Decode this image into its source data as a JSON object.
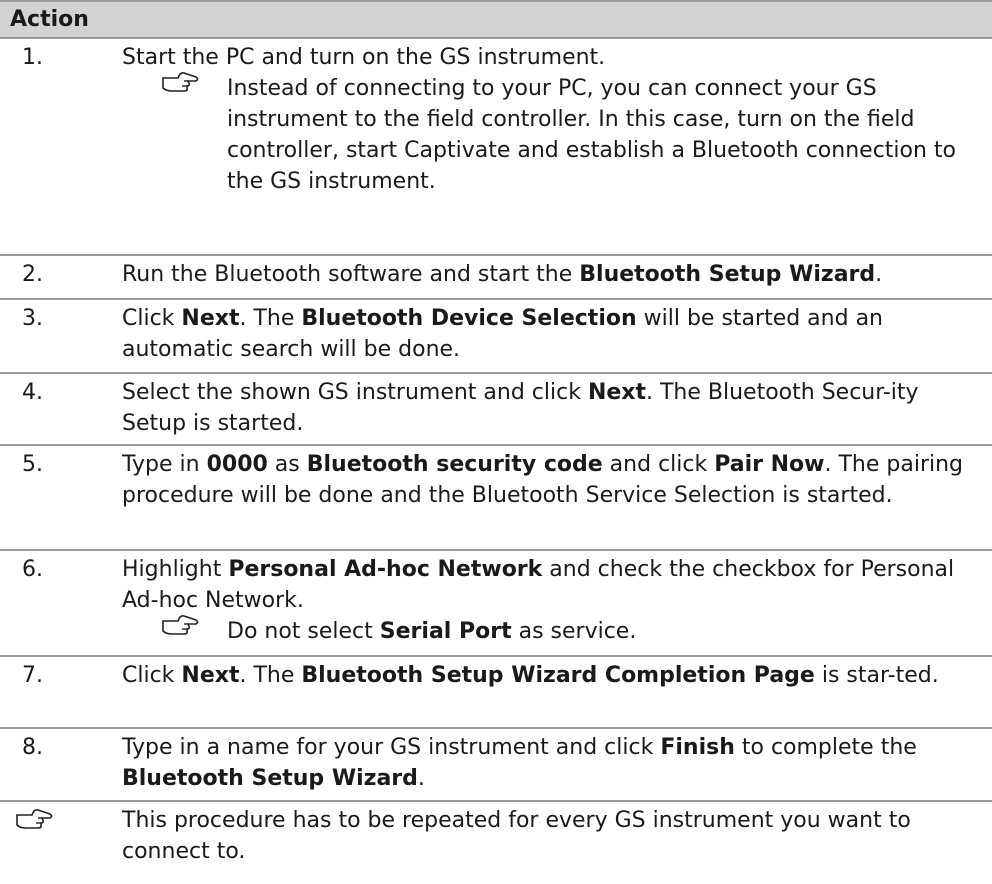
{
  "header": {
    "title": "Action"
  },
  "steps": [
    {
      "num": "1.",
      "parts": [
        "Start the PC and turn on the GS instrument."
      ],
      "note": "Instead of connecting to your PC, you can connect your GS instrument to the field controller. In this case, turn on the field controller, start Captivate and establish a Bluetooth connection to the GS instrument."
    },
    {
      "num": "2.",
      "parts": [
        "Run the Bluetooth software and start the ",
        "Bluetooth Setup Wizard",
        "."
      ]
    },
    {
      "num": "3.",
      "parts": [
        "Click ",
        "Next",
        ". The ",
        "Bluetooth Device Selection",
        " will be started and an automatic search will be done."
      ]
    },
    {
      "num": "4.",
      "parts": [
        "Select the shown GS instrument and click ",
        "Next",
        ". The Bluetooth Secur-ity Setup is started."
      ]
    },
    {
      "num": "5.",
      "parts": [
        "Type in ",
        "0000",
        " as ",
        "Bluetooth security code",
        " and click ",
        "Pair Now",
        ". The pairing procedure will be done and the Bluetooth Service Selection is started."
      ]
    },
    {
      "num": "6.",
      "parts": [
        "Highlight ",
        "Personal Ad-hoc Network",
        " and check the checkbox for Personal Ad-hoc Network."
      ],
      "note_parts": [
        "Do not select ",
        "Serial Port",
        " as service."
      ]
    },
    {
      "num": "7.",
      "parts": [
        "Click ",
        "Next",
        ". The ",
        "Bluetooth Setup Wizard Completion Page",
        " is star-ted."
      ]
    },
    {
      "num": "8.",
      "parts": [
        "Type in a name for your GS instrument and click ",
        "Finish",
        " to complete the ",
        "Bluetooth Setup Wizard",
        "."
      ]
    }
  ],
  "final_note": "This procedure has to be repeated for every GS instrument you want to connect to.",
  "icons": {
    "note": "pointing-hand-icon"
  }
}
